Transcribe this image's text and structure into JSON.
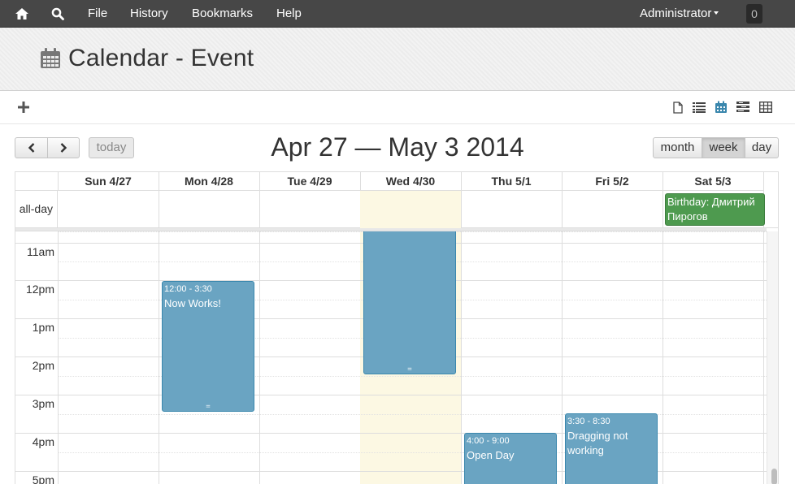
{
  "nav": {
    "file": "File",
    "history": "History",
    "bookmarks": "Bookmarks",
    "help": "Help",
    "user": "Administrator",
    "notifications": "0"
  },
  "page": {
    "title": "Calendar - Event"
  },
  "calendar": {
    "title": "Apr 27 — May 3 2014",
    "today_label": "today",
    "views": {
      "month": "month",
      "week": "week",
      "day": "day"
    },
    "active_view": "week",
    "days": [
      "Sun 4/27",
      "Mon 4/28",
      "Tue 4/29",
      "Wed 4/30",
      "Thu 5/1",
      "Fri 5/2",
      "Sat 5/3"
    ],
    "today_index": 3,
    "allday_label": "all-day",
    "time_labels": [
      "11am",
      "12pm",
      "1pm",
      "2pm",
      "3pm",
      "4pm",
      "5pm"
    ],
    "allday_events": [
      {
        "title": "Birthday: Дмитрий Пирогов",
        "day": "Sat 5/3",
        "color": "#4e9a4f"
      }
    ],
    "events": [
      {
        "time": "12:00 - 3:30",
        "title": "Now Works!",
        "day": "Mon 4/28"
      },
      {
        "time": "",
        "title": "",
        "day": "Wed 4/30",
        "ends": "2:30"
      },
      {
        "time": "4:00 - 9:00",
        "title": "Open Day",
        "day": "Thu 5/1"
      },
      {
        "time": "3:30 - 8:30",
        "title": "Dragging not working",
        "day": "Fri 5/2"
      }
    ],
    "event_color": "#6aa4c2",
    "today_color": "#fcf8e3"
  }
}
